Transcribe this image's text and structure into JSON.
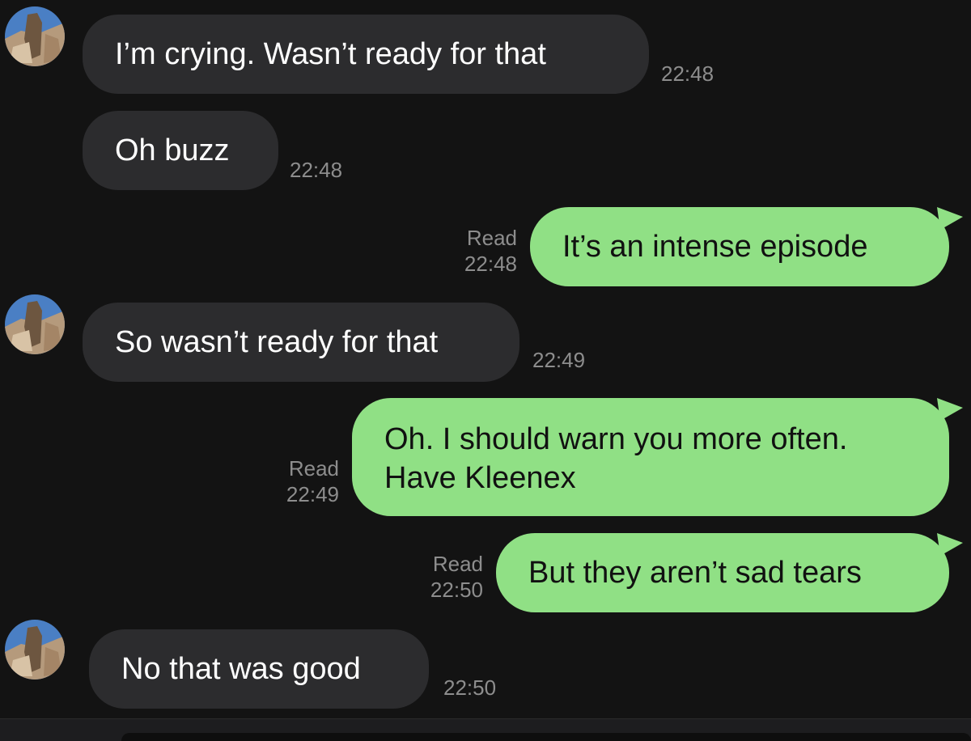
{
  "messages": [
    {
      "direction": "incoming",
      "text": "I’m crying. Wasn’t ready for that",
      "time": "22:48"
    },
    {
      "direction": "incoming",
      "text": "Oh buzz",
      "time": "22:48"
    },
    {
      "direction": "outgoing",
      "text": "It’s an intense episode",
      "status": "Read",
      "time": "22:48"
    },
    {
      "direction": "incoming",
      "text": "So wasn’t ready for that",
      "time": "22:49"
    },
    {
      "direction": "outgoing",
      "lines": [
        "Oh. I should warn you more often.",
        "Have Kleenex"
      ],
      "status": "Read",
      "time": "22:49"
    },
    {
      "direction": "outgoing",
      "text": "But they aren’t sad tears",
      "status": "Read",
      "time": "22:50"
    },
    {
      "direction": "incoming",
      "text": "No that was good",
      "time": "22:50"
    }
  ],
  "icons": {
    "avatar": "contact-avatar-photo"
  },
  "colors": {
    "background": "#131313",
    "incoming_bubble": "#2c2c2e",
    "outgoing_bubble": "#90e085",
    "meta_text": "#8d8d8d"
  }
}
